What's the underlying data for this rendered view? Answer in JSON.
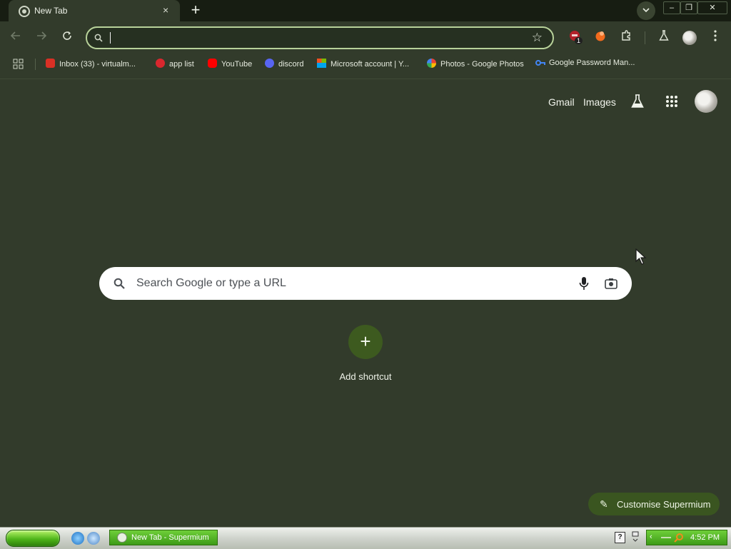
{
  "browser": {
    "tab_title": "New Tab",
    "tab_close": "×",
    "new_tab": "+",
    "window_buttons": [
      "–",
      "❐",
      "✕"
    ]
  },
  "toolbar": {
    "omnibox_value": "",
    "extension_badge": "1"
  },
  "bookmarks": [
    {
      "label": "Inbox (33) - virtualm...",
      "icon": "gmail-icon",
      "color": "#d93025"
    },
    {
      "label": "app list",
      "icon": "mega-icon",
      "color": "#d9272e"
    },
    {
      "label": "YouTube",
      "icon": "youtube-icon",
      "color": "#ff0000"
    },
    {
      "label": "discord",
      "icon": "discord-icon",
      "color": "#5865f2"
    },
    {
      "label": "Microsoft account | Y...",
      "icon": "microsoft-icon",
      "color": "#f25022"
    },
    {
      "label": "Photos - Google Photos",
      "icon": "google-photos-icon",
      "color": "#fbbc04"
    },
    {
      "label": "Google Password Man...",
      "icon": "key-icon",
      "color": "#4285f4"
    }
  ],
  "header": {
    "gmail": "Gmail",
    "images": "Images"
  },
  "search": {
    "placeholder": "Search Google or type a URL"
  },
  "shortcut": {
    "plus": "+",
    "label": "Add shortcut"
  },
  "customise": {
    "label": "Customise Supermium"
  },
  "taskbar": {
    "window_title": "New Tab - Supermium",
    "help": "?",
    "clock": "4:52 PM"
  },
  "colors": {
    "page_bg": "#323b2b",
    "accent": "#b8d29a",
    "taskbar_green": "#3d9b17"
  }
}
